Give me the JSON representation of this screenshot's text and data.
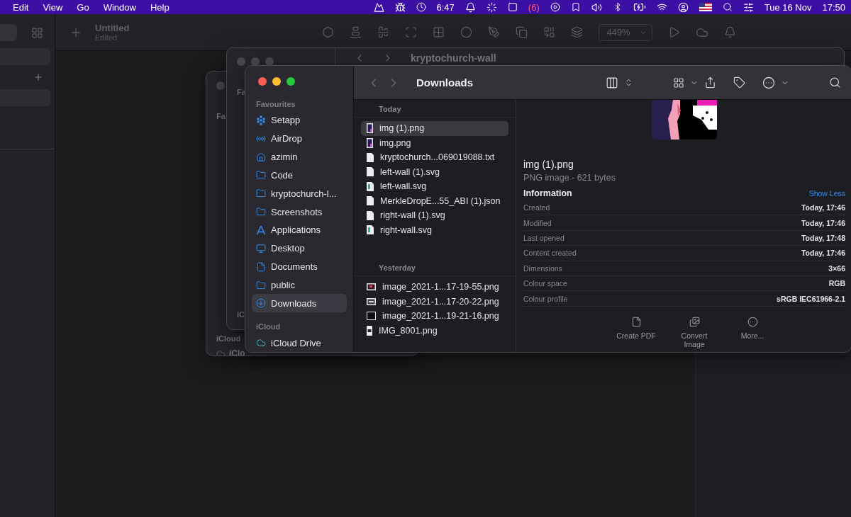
{
  "menu_bar": {
    "items": [
      "Edit",
      "View",
      "Go",
      "Window",
      "Help"
    ],
    "clock_app": "6:47",
    "badge": "(6)",
    "date": "Tue 16 Nov",
    "time": "17:50"
  },
  "app": {
    "title": "Untitled",
    "subtitle": "Edited",
    "zoom": "449%"
  },
  "back_windows": [
    {
      "texts": [
        "Fa",
        "iCloud",
        "iClo"
      ]
    },
    {
      "title": "kryptochurch-wall",
      "texts": [
        "Fa",
        "iC"
      ]
    }
  ],
  "finder": {
    "title": "Downloads",
    "sidebar": [
      {
        "heading": "Favourites",
        "items": [
          {
            "label": "Setapp",
            "kind": "setapp",
            "selected": false
          },
          {
            "label": "AirDrop",
            "kind": "airdrop",
            "selected": false
          },
          {
            "label": "azimin",
            "kind": "home",
            "selected": false
          },
          {
            "label": "Code",
            "kind": "folder",
            "selected": false
          },
          {
            "label": "kryptochurch-l...",
            "kind": "folder",
            "selected": false
          },
          {
            "label": "Screenshots",
            "kind": "folder",
            "selected": false
          },
          {
            "label": "Applications",
            "kind": "apps",
            "selected": false
          },
          {
            "label": "Desktop",
            "kind": "desktop",
            "selected": false
          },
          {
            "label": "Documents",
            "kind": "document",
            "selected": false
          },
          {
            "label": "public",
            "kind": "folder",
            "selected": false
          },
          {
            "label": "Downloads",
            "kind": "download",
            "selected": true
          }
        ]
      },
      {
        "heading": "iCloud",
        "items": [
          {
            "label": "iCloud Drive",
            "kind": "cloud",
            "selected": false
          }
        ]
      }
    ],
    "files": [
      {
        "heading": "Today",
        "items": [
          {
            "name": "img (1).png",
            "kind": "tall",
            "selected": true
          },
          {
            "name": "img.png",
            "kind": "tall",
            "selected": false
          },
          {
            "name": "kryptochurch...069019088.txt",
            "kind": "page",
            "selected": false
          },
          {
            "name": "left-wall (1).svg",
            "kind": "page",
            "selected": false
          },
          {
            "name": "left-wall.svg",
            "kind": "green",
            "selected": false
          },
          {
            "name": "MerkleDropE...55_ABI (1).json",
            "kind": "page",
            "selected": false
          },
          {
            "name": "right-wall (1).svg",
            "kind": "page",
            "selected": false
          },
          {
            "name": "right-wall.svg",
            "kind": "green",
            "selected": false
          }
        ]
      },
      {
        "heading": "Yesterday",
        "items": [
          {
            "name": "image_2021-1...17-19-55.png",
            "kind": "wide",
            "selected": false
          },
          {
            "name": "image_2021-1...17-20-22.png",
            "kind": "window",
            "selected": false
          },
          {
            "name": "image_2021-1...19-21-16.png",
            "kind": "dark",
            "selected": false
          },
          {
            "name": "IMG_8001.png",
            "kind": "phone",
            "selected": false
          }
        ]
      }
    ],
    "preview": {
      "name": "img (1).png",
      "kind": "PNG image - 621 bytes",
      "section": "Information",
      "toggle": "Show Less",
      "rows": [
        {
          "label": "Created",
          "value": "Today, 17:46"
        },
        {
          "label": "Modified",
          "value": "Today, 17:46"
        },
        {
          "label": "Last opened",
          "value": "Today, 17:48"
        },
        {
          "label": "Content created",
          "value": "Today, 17:46"
        },
        {
          "label": "Dimensions",
          "value": "3×66"
        },
        {
          "label": "Colour space",
          "value": "RGB"
        },
        {
          "label": "Colour profile",
          "value": "sRGB IEC61966-2.1"
        }
      ],
      "actions": [
        {
          "label": "Create PDF",
          "kind": "document"
        },
        {
          "label": "Convert Image",
          "kind": "images"
        },
        {
          "label": "More...",
          "kind": "more"
        }
      ]
    }
  }
}
